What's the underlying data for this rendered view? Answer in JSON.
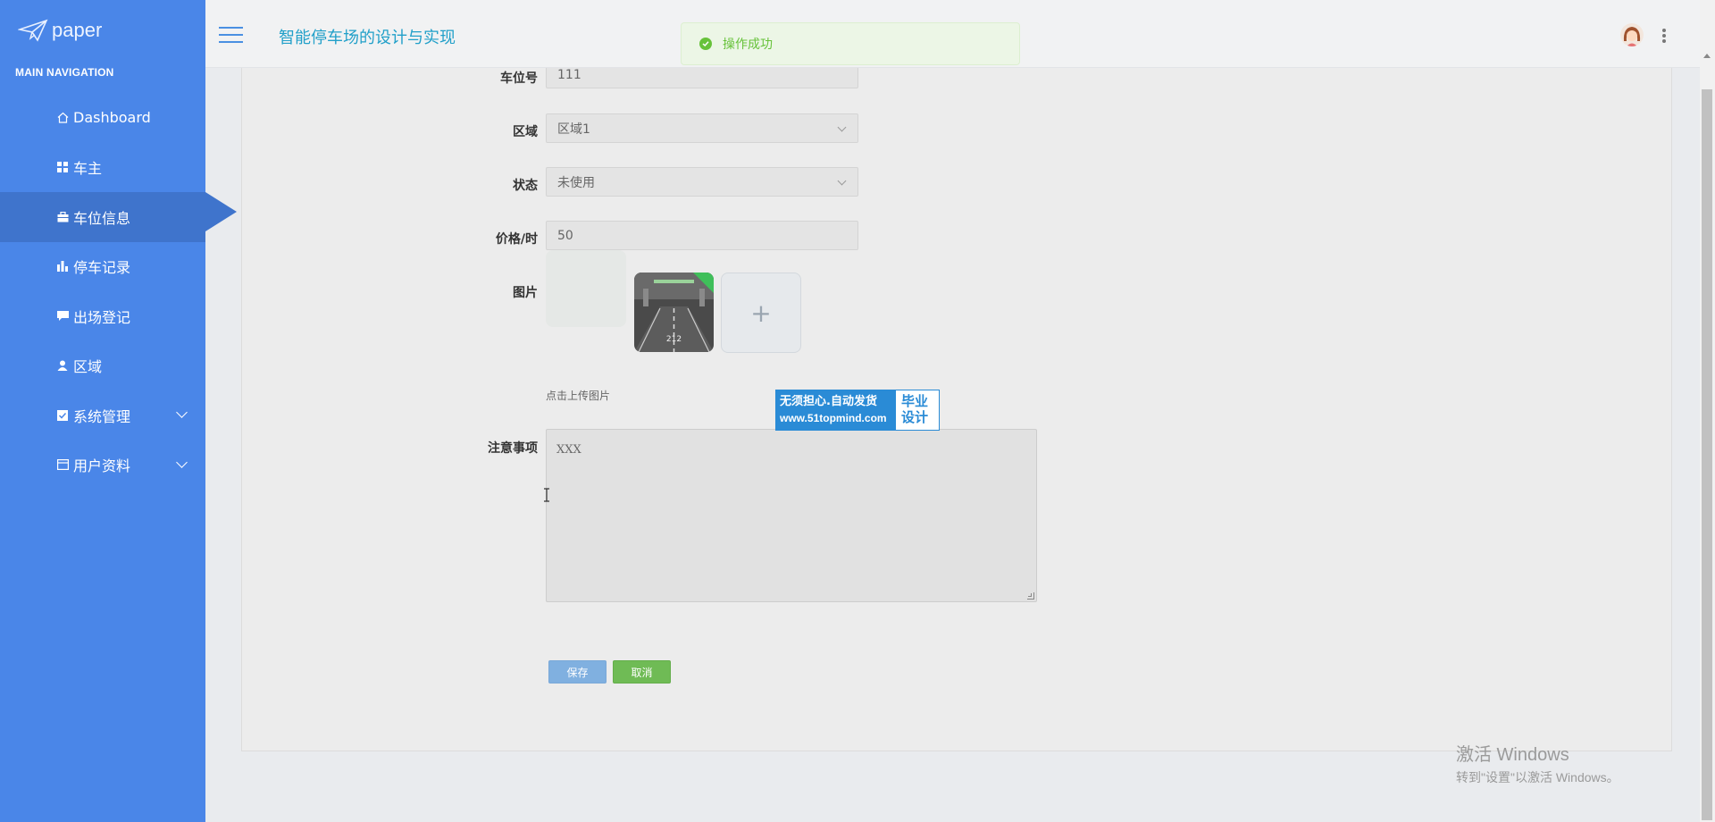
{
  "sidebar": {
    "logo_text": "paper",
    "nav_header": "MAIN NAVIGATION",
    "items": [
      {
        "label": "Dashboard",
        "icon": "home-icon"
      },
      {
        "label": "车主",
        "icon": "grid-icon"
      },
      {
        "label": "车位信息",
        "icon": "briefcase-icon",
        "active": true
      },
      {
        "label": "停车记录",
        "icon": "bar-chart-icon"
      },
      {
        "label": "出场登记",
        "icon": "comment-icon"
      },
      {
        "label": "区域",
        "icon": "user-icon"
      },
      {
        "label": "系统管理",
        "icon": "check-square-icon",
        "expandable": true
      },
      {
        "label": "用户资料",
        "icon": "calendar-icon",
        "expandable": true
      }
    ]
  },
  "header": {
    "app_title": "智能停车场的设计与实现"
  },
  "toast": {
    "message": "操作成功"
  },
  "form": {
    "space_no": {
      "label": "车位号",
      "value": "111"
    },
    "area": {
      "label": "区域",
      "value": "区域1"
    },
    "status": {
      "label": "状态",
      "value": "未使用"
    },
    "price": {
      "label": "价格/时",
      "value": "50"
    },
    "image": {
      "label": "图片",
      "hint": "点击上传图片",
      "upload_symbol": "+"
    },
    "notes": {
      "label": "注意事项",
      "value": "XXX"
    },
    "save_label": "保存",
    "cancel_label": "取消"
  },
  "watermark": {
    "line1": "无须担心.自动发货",
    "line2": "www.51topmind.com",
    "right1": "毕业",
    "right2": "设计"
  },
  "windows_activation": {
    "title": "激活 Windows",
    "subtitle": "转到\"设置\"以激活 Windows。"
  },
  "colors": {
    "sidebar": "#4a86e8",
    "sidebar_active": "#3f74cc",
    "title": "#22a0c9",
    "success": "#67c23a",
    "save_button": "#80b0e0",
    "cancel_button": "#6fbb55"
  }
}
